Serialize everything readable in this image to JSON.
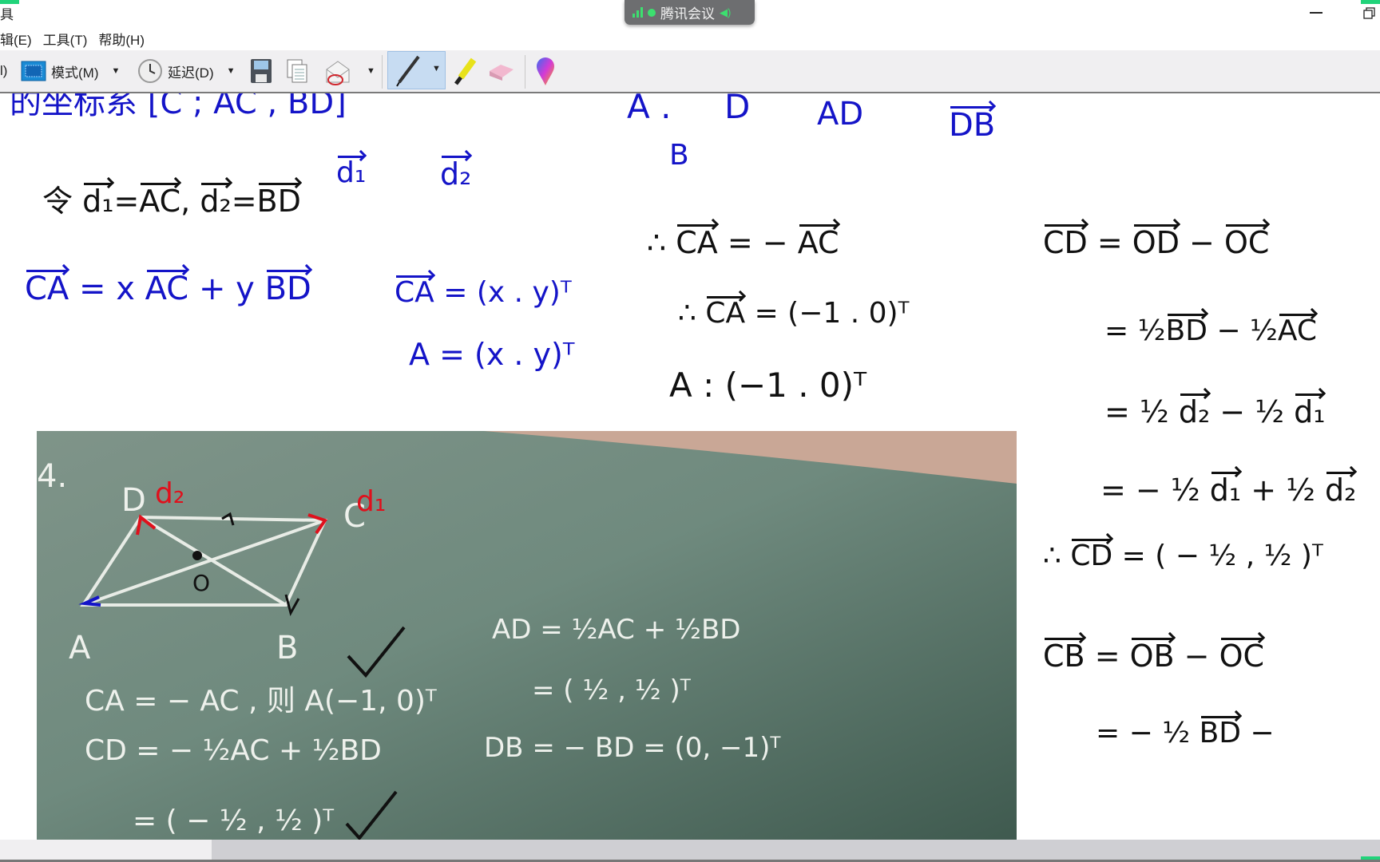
{
  "window": {
    "title_fragment": "具",
    "meeting_badge": "腾讯会议",
    "accent_green": "#21d37a"
  },
  "menu": [
    "辑(E)",
    "工具(T)",
    "帮助(H)"
  ],
  "toolbar": {
    "cut_fragment": "l)",
    "mode_label": "模式(M)",
    "delay_label": "延迟(D)",
    "icons": [
      "mode-icon",
      "clock-icon",
      "save-icon",
      "copy-icon",
      "send-email-icon",
      "pen-icon",
      "highlighter-icon",
      "eraser-icon",
      "color-picker-icon"
    ]
  },
  "notes": {
    "colors": {
      "blue": "#1414c8",
      "black": "#111111",
      "red": "#e0101c"
    },
    "lines": [
      {
        "color": "blue",
        "parts": [
          "的坐标系 [C ; AC ,  BD]"
        ]
      },
      {
        "color": "blue",
        "parts": [
          "A ."
        ]
      },
      {
        "color": "blue",
        "parts": [
          "D"
        ]
      },
      {
        "color": "blue",
        "parts": [
          "AD"
        ]
      },
      {
        "color": "blue",
        "parts": [
          {
            "vec": "DB"
          }
        ]
      },
      {
        "color": "blue",
        "parts": [
          "B"
        ]
      },
      {
        "color": "blue",
        "parts": [
          {
            "vec": "d₁"
          }
        ]
      },
      {
        "color": "blue",
        "parts": [
          {
            "vec": "d₂"
          }
        ]
      },
      {
        "color": "black",
        "parts": [
          "令  ",
          {
            "vec": "d₁"
          },
          "=",
          {
            "vec": "AC"
          },
          ",  ",
          {
            "vec": "d₂"
          },
          "=",
          {
            "vec": "BD"
          }
        ]
      },
      {
        "color": "blue",
        "parts": [
          {
            "vec": "CA"
          },
          "  = x ",
          {
            "vec": "AC"
          },
          " + y ",
          {
            "vec": "BD"
          }
        ]
      },
      {
        "color": "blue",
        "parts": [
          {
            "vec": "CA"
          },
          " = (x . y)ᵀ"
        ]
      },
      {
        "color": "blue",
        "parts": [
          "A = (x . y)ᵀ"
        ]
      },
      {
        "color": "black",
        "parts": [
          "∴  ",
          {
            "vec": "CA"
          },
          " =  −  ",
          {
            "vec": "AC"
          }
        ]
      },
      {
        "color": "black",
        "parts": [
          "∴ ",
          {
            "vec": "CA"
          },
          " = (−1 . 0)ᵀ"
        ]
      },
      {
        "color": "black",
        "parts": [
          "A : (−1 . 0)ᵀ"
        ]
      },
      {
        "color": "black",
        "parts": [
          {
            "vec": "CD"
          },
          " =  ",
          {
            "vec": "OD"
          },
          " −  ",
          {
            "vec": "OC"
          }
        ]
      },
      {
        "color": "black",
        "parts": [
          "= ½",
          {
            "vec": "BD"
          },
          " −  ½",
          {
            "vec": "AC"
          }
        ]
      },
      {
        "color": "black",
        "parts": [
          "=  ½ ",
          {
            "vec": "d₂"
          },
          " −  ½ ",
          {
            "vec": "d₁"
          }
        ]
      },
      {
        "color": "black",
        "parts": [
          "=  − ½ ",
          {
            "vec": "d₁"
          },
          "  +  ½ ",
          {
            "vec": "d₂"
          }
        ]
      },
      {
        "color": "black",
        "parts": [
          "∴  ",
          {
            "vec": "CD"
          },
          "  = ( − ½ , ½ )ᵀ"
        ]
      },
      {
        "color": "black",
        "parts": [
          {
            "vec": "CB"
          },
          " =   ",
          {
            "vec": "OB"
          },
          " −  ",
          {
            "vec": "OC"
          }
        ]
      },
      {
        "color": "black",
        "parts": [
          "=  − ½ ",
          {
            "vec": "BD"
          },
          " −"
        ]
      }
    ]
  },
  "photo": {
    "problem_number": "4.",
    "vertices": {
      "A": "A",
      "B": "B",
      "C": "C",
      "D": "D",
      "O": "O"
    },
    "red_labels": [
      "d₁",
      "d₂"
    ],
    "chalk": [
      "CA = − AC , 则 A(−1, 0)ᵀ",
      "CD = − ½AC + ½BD",
      "= ( − ½ , ½ )ᵀ",
      "AD = ½AC + ½BD",
      "= ( ½ , ½ )ᵀ",
      "DB = − BD = (0, −1)ᵀ"
    ]
  }
}
